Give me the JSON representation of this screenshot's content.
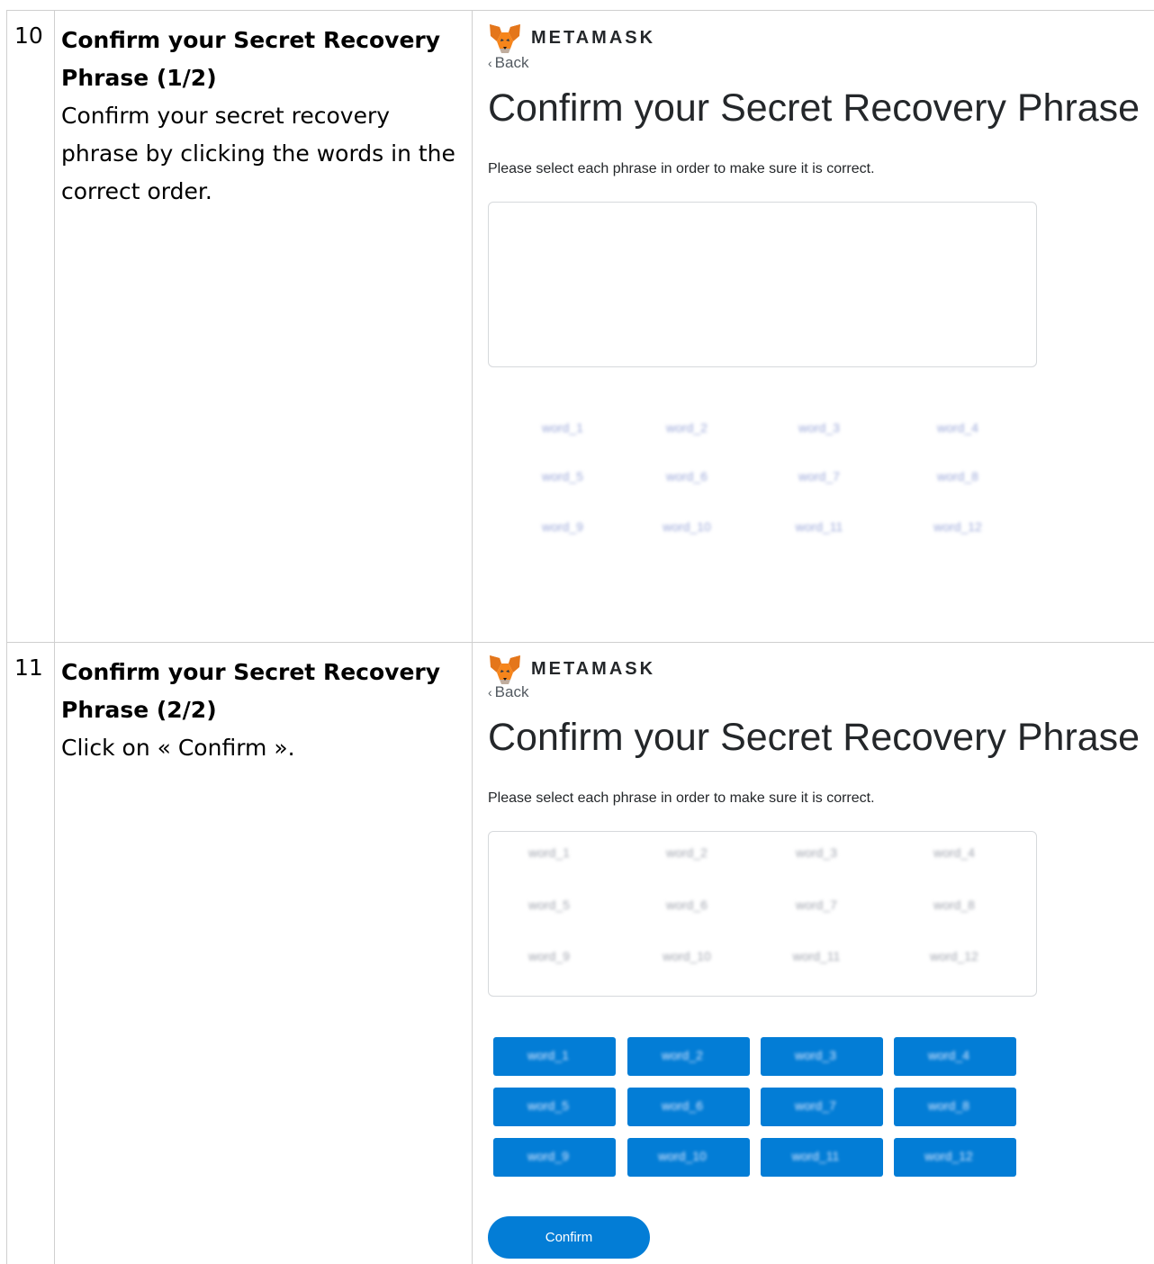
{
  "rows": [
    {
      "number": "10",
      "title": "Confirm your Secret Recovery Phrase (1/2)",
      "body": "Confirm your secret recovery phrase by clicking the words in the correct order.",
      "screenshot": {
        "brand": "METAMASK",
        "back_label": "Back",
        "heading": "Confirm your Secret Recovery Phrase",
        "instruction": "Please select each phrase in order to make sure it is correct.",
        "words": [
          "word_1",
          "word_2",
          "word_3",
          "word_4",
          "word_5",
          "word_6",
          "word_7",
          "word_8",
          "word_9",
          "word_10",
          "word_11",
          "word_12"
        ]
      }
    },
    {
      "number": "11",
      "title": "Confirm your Secret Recovery Phrase (2/2)",
      "body": "Click on « Confirm ».",
      "screenshot": {
        "brand": "METAMASK",
        "back_label": "Back",
        "heading": "Confirm your Secret Recovery Phrase",
        "instruction": "Please select each phrase in order to make sure it is correct.",
        "selected_words": [
          "word_1",
          "word_2",
          "word_3",
          "word_4",
          "word_5",
          "word_6",
          "word_7",
          "word_8",
          "word_9",
          "word_10",
          "word_11",
          "word_12"
        ],
        "word_buttons": [
          "word_1",
          "word_2",
          "word_3",
          "word_4",
          "word_5",
          "word_6",
          "word_7",
          "word_8",
          "word_9",
          "word_10",
          "word_11",
          "word_12"
        ],
        "confirm_label": "Confirm"
      }
    }
  ],
  "colors": {
    "accent": "#037dd6",
    "fox_orange": "#e2761b",
    "border": "#cfcfcf"
  }
}
